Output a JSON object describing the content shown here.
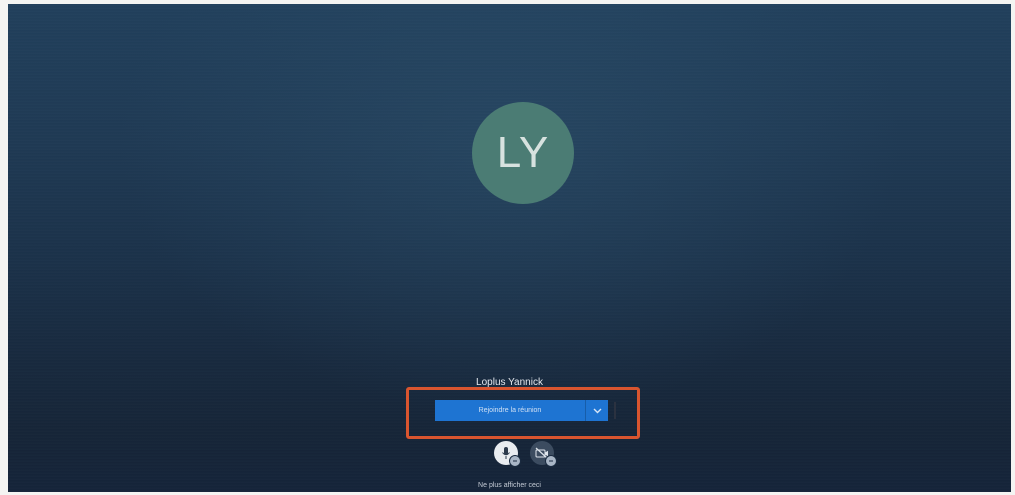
{
  "avatar": {
    "initials": "LY"
  },
  "user": {
    "name": "Loplus Yannick"
  },
  "join": {
    "label": "Rejoindre la réunion"
  },
  "footer": {
    "dont_show_label": "Ne plus afficher ceci"
  },
  "icons": {
    "mic": "microphone-icon",
    "camera": "camera-off-icon",
    "dropdown": "chevron-down-icon"
  },
  "colors": {
    "background_top": "#21405c",
    "background_bottom": "#15243a",
    "avatar": "#4b7c74",
    "join_button": "#1e74d2",
    "highlight": "#d9552f"
  }
}
